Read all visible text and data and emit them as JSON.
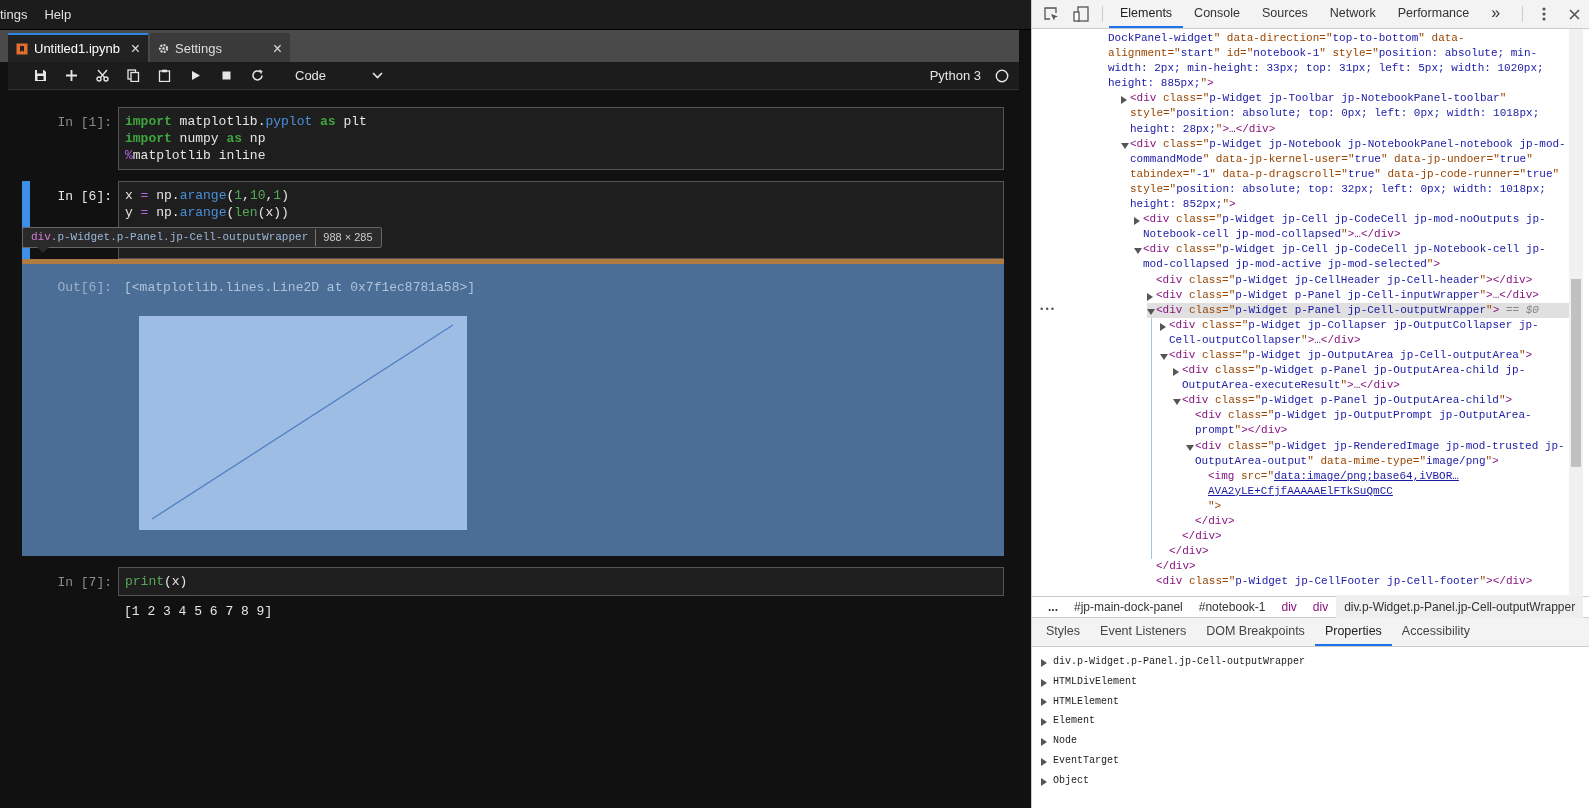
{
  "menu_bar": {
    "items": [
      "tings",
      "Help"
    ]
  },
  "notebook_tabs": [
    {
      "label": "Untitled1.ipynb",
      "kind": "notebook",
      "selected": true,
      "close": "×"
    },
    {
      "label": "Settings",
      "kind": "settings",
      "selected": false,
      "close": "×"
    }
  ],
  "toolbar": {
    "cell_type": "Code",
    "kernel": "Python 3"
  },
  "cells": [
    {
      "prompt": "In [1]:",
      "active": false,
      "inspected": false,
      "lines": [
        [
          {
            "text": "import",
            "kind": "kw"
          },
          {
            "text": " matplotlib.",
            "kind": "plain"
          },
          {
            "text": "pyplot",
            "kind": "attr"
          },
          {
            "text": " as",
            "kind": "kw"
          },
          {
            "text": " plt",
            "kind": "plain"
          }
        ],
        [
          {
            "text": "import",
            "kind": "kw"
          },
          {
            "text": " numpy ",
            "kind": "plain"
          },
          {
            "text": "as",
            "kind": "kw"
          },
          {
            "text": " np",
            "kind": "plain"
          }
        ],
        [
          {
            "text": "%",
            "kind": "op"
          },
          {
            "text": "matplotlib inline",
            "kind": "plain"
          }
        ]
      ]
    },
    {
      "prompt": "In [6]:",
      "active": true,
      "inspected": true,
      "lines": [
        [
          {
            "text": "x ",
            "kind": "plain"
          },
          {
            "text": "=",
            "kind": "op"
          },
          {
            "text": " np.",
            "kind": "plain"
          },
          {
            "text": "arange",
            "kind": "attr"
          },
          {
            "text": "(",
            "kind": "plain"
          },
          {
            "text": "1",
            "kind": "num"
          },
          {
            "text": ",",
            "kind": "plain"
          },
          {
            "text": "10",
            "kind": "num"
          },
          {
            "text": ",",
            "kind": "plain"
          },
          {
            "text": "1",
            "kind": "num"
          },
          {
            "text": ")",
            "kind": "plain"
          }
        ],
        [
          {
            "text": "y ",
            "kind": "plain"
          },
          {
            "text": "=",
            "kind": "op"
          },
          {
            "text": " np.",
            "kind": "plain"
          },
          {
            "text": "arange",
            "kind": "attr"
          },
          {
            "text": "(",
            "kind": "plain"
          },
          {
            "text": "len",
            "kind": "num"
          },
          {
            "text": "(x))",
            "kind": "plain"
          }
        ]
      ],
      "tooltip": {
        "tag": "div",
        "selector": ".p-Widget.p-Panel.jp-Cell-outputWrapper",
        "size": "988 × 285"
      },
      "outputs": [
        {
          "kind": "text",
          "prompt": "Out[6]:",
          "text": "[<matplotlib.lines.Line2D at 0x7f1ec8781a58>]"
        },
        {
          "kind": "image"
        }
      ]
    },
    {
      "prompt": "In [7]:",
      "active": false,
      "inspected": false,
      "lines": [
        [
          {
            "text": "print",
            "kind": "num"
          },
          {
            "text": "(x)",
            "kind": "plain"
          }
        ]
      ],
      "outputs": [
        {
          "kind": "text",
          "text": "[1 2 3 4 5 6 7 8 9]"
        }
      ]
    }
  ],
  "devtools": {
    "tabs": [
      {
        "label": "Elements",
        "selected": true
      },
      {
        "label": "Console",
        "selected": false
      },
      {
        "label": "Sources",
        "selected": false
      },
      {
        "label": "Network",
        "selected": false
      },
      {
        "label": "Performance",
        "selected": false
      }
    ],
    "more_tabs": "»",
    "dom_tree": [
      {
        "kind": "partial",
        "selected": false,
        "text": "DockPanel-widget\" data-direction=\"top-to-bottom\" data-alignment=\"start\" id=\"notebook-1\" style=\"position: absolute; min-width: 2px; min-height: 33px; top: 31px; left: 5px; width: 1020px; height: 885px;\">",
        "children": [
          {
            "kind": "element",
            "expanded": false,
            "selected": false,
            "text": "<div class=\"p-Widget jp-Toolbar jp-NotebookPanel-toolbar\" style=\"position: absolute; top: 0px; left: 0px; width: 1018px; height: 28px;\">…</div>"
          },
          {
            "kind": "element",
            "expanded": true,
            "selected": false,
            "text": "<div class=\"p-Widget jp-Notebook jp-NotebookPanel-notebook jp-mod-commandMode\" data-jp-kernel-user=\"true\" data-jp-undoer=\"true\" tabindex=\"-1\" data-p-dragscroll=\"true\" data-jp-code-runner=\"true\" style=\"position: absolute; top: 32px; left: 0px; width: 1018px; height: 852px;\">",
            "children": [
              {
                "kind": "element",
                "expanded": false,
                "selected": false,
                "text": "<div class=\"p-Widget jp-Cell jp-CodeCell jp-mod-noOutputs jp-Notebook-cell jp-mod-collapsed\">…</div>"
              },
              {
                "kind": "element",
                "expanded": true,
                "selected": false,
                "text": "<div class=\"p-Widget jp-Cell jp-CodeCell jp-Notebook-cell jp-mod-collapsed jp-mod-active jp-mod-selected\">",
                "children": [
                  {
                    "kind": "leaf",
                    "selected": false,
                    "text": "<div class=\"p-Widget jp-CellHeader jp-Cell-header\"></div>"
                  },
                  {
                    "kind": "element",
                    "expanded": false,
                    "selected": false,
                    "text": "<div class=\"p-Widget p-Panel jp-Cell-inputWrapper\">…</div>"
                  },
                  {
                    "kind": "element",
                    "expanded": true,
                    "selected": true,
                    "gutter": "•••",
                    "suffix": "== $0",
                    "text": "<div class=\"p-Widget p-Panel jp-Cell-outputWrapper\">",
                    "close": "</div>",
                    "children": [
                      {
                        "kind": "element",
                        "expanded": false,
                        "selected": false,
                        "text": "<div class=\"p-Widget jp-Collapser jp-OutputCollapser jp-Cell-outputCollapser\">…</div>"
                      },
                      {
                        "kind": "element",
                        "expanded": true,
                        "selected": false,
                        "text": "<div class=\"p-Widget jp-OutputArea jp-Cell-outputArea\">",
                        "close": "</div>",
                        "children": [
                          {
                            "kind": "element",
                            "expanded": false,
                            "selected": false,
                            "text": "<div class=\"p-Widget p-Panel jp-OutputArea-child jp-OutputArea-executeResult\">…</div>"
                          },
                          {
                            "kind": "element",
                            "expanded": true,
                            "selected": false,
                            "text": "<div class=\"p-Widget p-Panel jp-OutputArea-child\">",
                            "close": "</div>",
                            "children": [
                              {
                                "kind": "leaf",
                                "selected": false,
                                "text": "<div class=\"p-Widget jp-OutputPrompt jp-OutputArea-prompt\"></div>"
                              },
                              {
                                "kind": "element",
                                "expanded": true,
                                "selected": false,
                                "text": "<div class=\"p-Widget jp-RenderedImage jp-mod-trusted jp-OutputArea-output\" data-mime-type=\"image/png\">",
                                "close": "</div>",
                                "children": [
                                  {
                                    "kind": "img",
                                    "selected": false,
                                    "text": "<img src=\"",
                                    "links": [
                                      "data:image/png;base64,iVBOR…",
                                      "AVA2yLE+CfjfAAAAAElFTkSuQmCC"
                                    ],
                                    "end": "\">"
                                  }
                                ]
                              }
                            ]
                          }
                        ]
                      }
                    ]
                  },
                  {
                    "kind": "leaf",
                    "selected": false,
                    "text": "<div class=\"p-Widget jp-CellFooter jp-Cell-footer\"></div>"
                  }
                ]
              }
            ]
          }
        ]
      }
    ],
    "breadcrumbs": [
      {
        "text": "...",
        "kind": "more",
        "selected": false
      },
      {
        "text": "#jp-main-dock-panel",
        "kind": "id",
        "selected": false
      },
      {
        "text": "#notebook-1",
        "kind": "id",
        "selected": false
      },
      {
        "text": "div",
        "kind": "tag",
        "selected": false
      },
      {
        "text": "div",
        "kind": "tag",
        "selected": false
      },
      {
        "text": "div.p-Widget.p-Panel.jp-Cell-outputWrapper",
        "kind": "selector",
        "selected": true
      }
    ],
    "panel_tabs": [
      {
        "label": "Styles",
        "selected": false
      },
      {
        "label": "Event Listeners",
        "selected": false
      },
      {
        "label": "DOM Breakpoints",
        "selected": false
      },
      {
        "label": "Properties",
        "selected": true
      },
      {
        "label": "Accessibility",
        "selected": false
      }
    ],
    "properties": [
      {
        "label": "div.p-Widget.p-Panel.jp-Cell-outputWrapper",
        "expanded": false
      },
      {
        "label": "HTMLDivElement",
        "expanded": false
      },
      {
        "label": "HTMLElement",
        "expanded": false
      },
      {
        "label": "Element",
        "expanded": false
      },
      {
        "label": "Node",
        "expanded": false
      },
      {
        "label": "EventTarget",
        "expanded": false
      },
      {
        "label": "Object",
        "expanded": false
      }
    ]
  }
}
